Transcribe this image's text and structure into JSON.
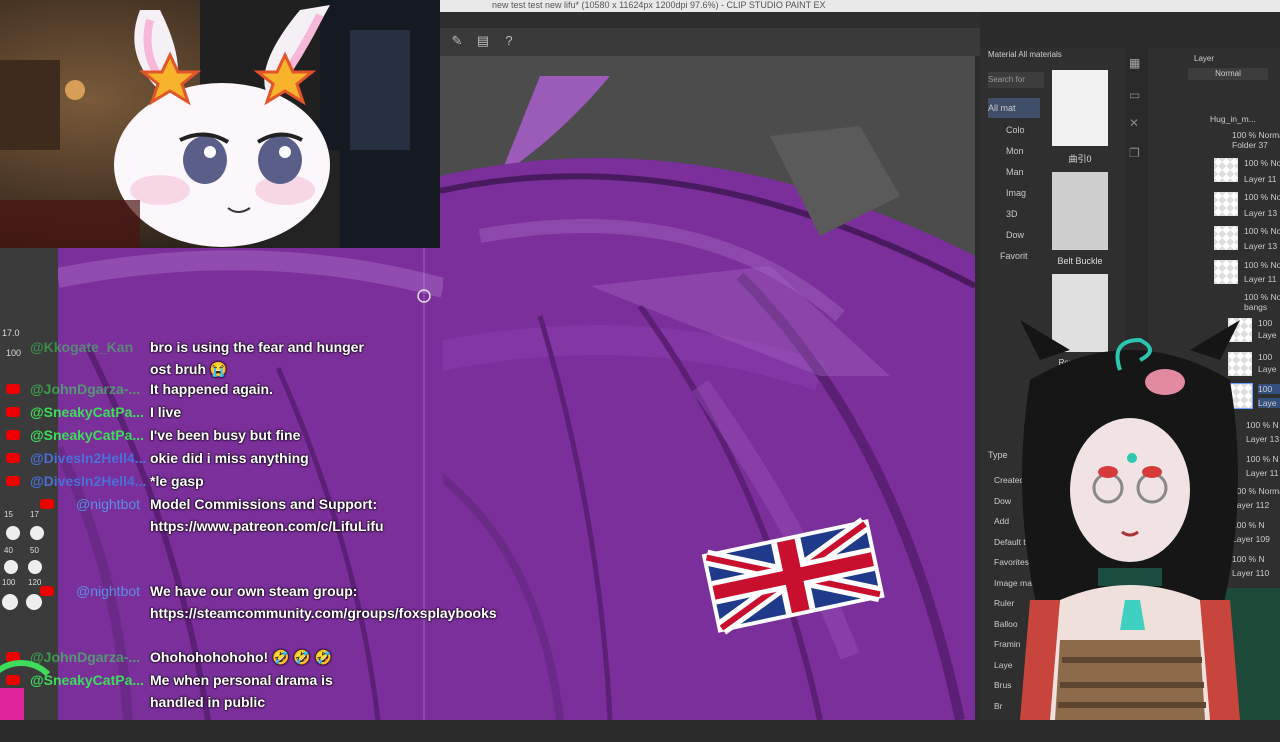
{
  "window": {
    "title": "new test test new lifu* (10580 x 11624px 1200dpi 97.6%) - CLIP STUDIO PAINT EX"
  },
  "left_tool": {
    "size_value": "17.0",
    "opacity_value": "100",
    "brush_sizes": [
      "15",
      "17",
      "40",
      "50",
      "100",
      "120"
    ]
  },
  "material_panel": {
    "header": "Material  All materials",
    "search_placeholder": "Search for",
    "tree": [
      "All mat",
      "Colo",
      "Mon",
      "Man",
      "Imag",
      "3D",
      "Dow",
      "Favorit"
    ],
    "items": [
      {
        "label": "曲引0"
      },
      {
        "label": "Belt Buckle"
      },
      {
        "label": "Rorel Belt B"
      }
    ],
    "filter": {
      "type_label": "Type",
      "options": [
        "Created",
        "Dow",
        "Add",
        "Default ta",
        "Favorites",
        "Image mat",
        "Ruler",
        "Balloo",
        "Framin",
        "Laye",
        "Brus",
        "Br"
      ]
    }
  },
  "layer_panel": {
    "header": "Layer",
    "blend_mode": "Normal",
    "layers": [
      {
        "opacity": "",
        "name": "Hug_in_m..."
      },
      {
        "opacity": "100 % Norma",
        "name": "Folder 37"
      },
      {
        "opacity": "100 % No",
        "name": "Layer 11"
      },
      {
        "opacity": "100 % No",
        "name": "Layer 13"
      },
      {
        "opacity": "100 % No",
        "name": "Layer 13"
      },
      {
        "opacity": "100 % No",
        "name": "Layer 11"
      },
      {
        "opacity": "100 % Norma",
        "name": "bangs"
      },
      {
        "opacity": "100",
        "name": "Laye"
      },
      {
        "opacity": "100",
        "name": "Laye"
      },
      {
        "opacity": "100",
        "name": "Laye"
      },
      {
        "opacity": "100 % N",
        "name": "Layer 13"
      },
      {
        "opacity": "100 % N",
        "name": "Layer 11"
      },
      {
        "opacity": "100 % Norma",
        "name": "Layer 112"
      },
      {
        "opacity": "100 % N",
        "name": "Layer 109"
      },
      {
        "opacity": "100 % N",
        "name": "Layer 110"
      }
    ]
  },
  "chat": {
    "colors": {
      "green": "#3ddc5a",
      "blue": "#4b6fd8",
      "nightbot": "#5b8fe8"
    },
    "messages": [
      {
        "author": "@Kkogate_Kan",
        "color": "green",
        "text": "bro is using the fear and hunger ost bruh 😭"
      },
      {
        "author": "@JohnDgarza-...",
        "color": "green",
        "text": "It happened again."
      },
      {
        "author": "@SneakyCatPa...",
        "color": "green",
        "text": "I live"
      },
      {
        "author": "@SneakyCatPa...",
        "color": "green",
        "text": "I've been busy but fine"
      },
      {
        "author": "@DivesIn2Hell4...",
        "color": "blue",
        "text": "okie did i miss anything"
      },
      {
        "author": "@DivesIn2Hell4...",
        "color": "blue",
        "text": "*le gasp"
      },
      {
        "author": "@nightbot",
        "color": "nightbot",
        "text": "Model Commissions and Support: https://www.patreon.com/c/LifuLifu"
      },
      {
        "author": "@nightbot",
        "color": "nightbot",
        "text": "We have our own steam group: https://steamcommunity.com/groups/foxsplaybooks"
      },
      {
        "author": "@JohnDgarza-...",
        "color": "green",
        "text": "Ohohohohohoho! 🤣 🤣 🤣"
      },
      {
        "author": "@SneakyCatPa...",
        "color": "green",
        "text": "Me when personal drama is handled in public"
      }
    ]
  }
}
